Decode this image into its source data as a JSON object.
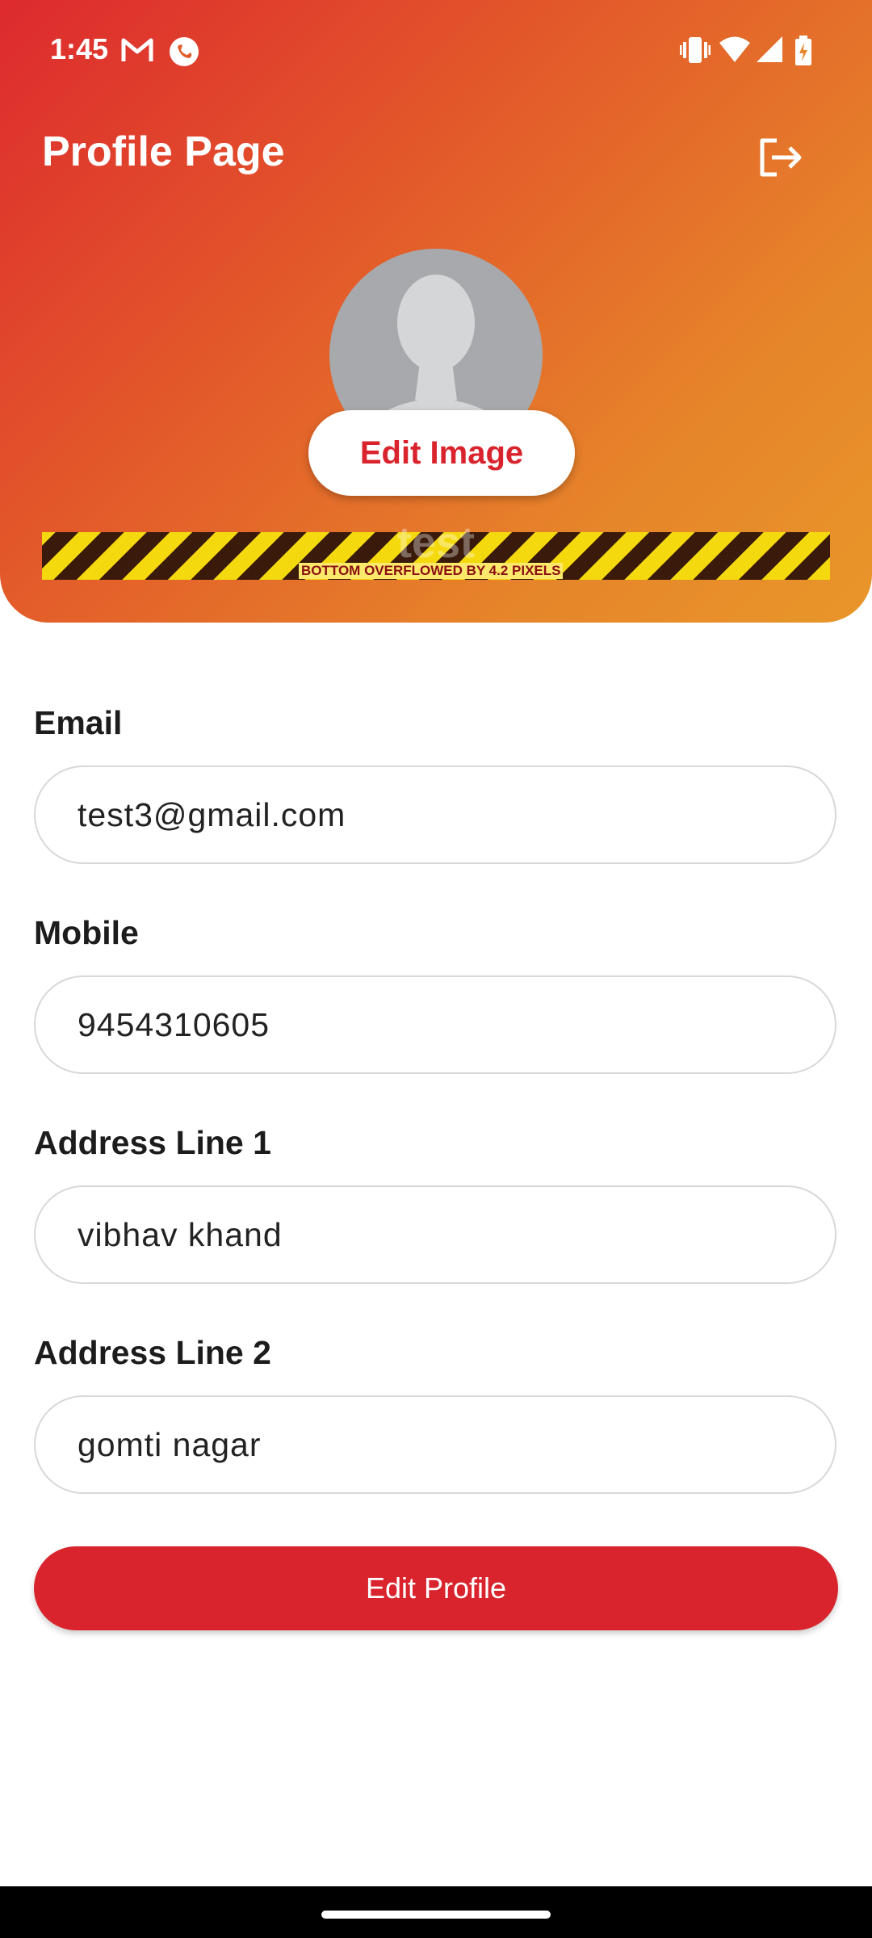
{
  "status_bar": {
    "time": "1:45",
    "icons": [
      "gmail-icon",
      "app-notification-icon",
      "vibrate-icon",
      "wifi-icon",
      "cellular-icon",
      "battery-charging-icon"
    ]
  },
  "header": {
    "title": "Profile Page",
    "logout_icon": "logout-icon",
    "edit_image_label": "Edit Image",
    "username": "test",
    "overflow_warning": "BOTTOM OVERFLOWED BY 4.2 PIXELS"
  },
  "form": {
    "email": {
      "label": "Email",
      "value": "test3@gmail.com"
    },
    "mobile": {
      "label": "Mobile",
      "value": "9454310605"
    },
    "address1": {
      "label": "Address Line 1",
      "value": "vibhav khand"
    },
    "address2": {
      "label": "Address Line 2",
      "value": "gomti nagar"
    }
  },
  "actions": {
    "edit_profile_label": "Edit Profile"
  },
  "colors": {
    "gradient_start": "#dd2a2e",
    "gradient_end": "#e9962a",
    "primary": "#d9232d",
    "avatar_bg": "#a7a9ac"
  }
}
